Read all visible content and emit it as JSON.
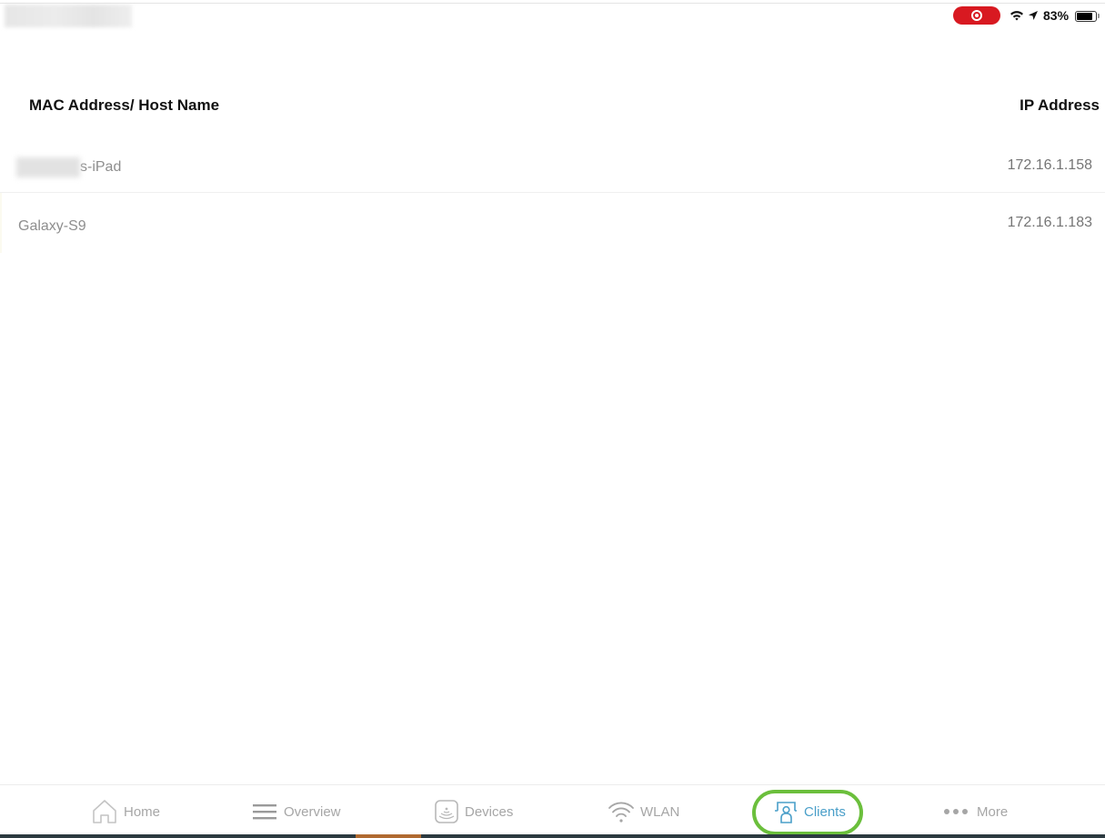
{
  "status_bar": {
    "app_title_blurred": "",
    "recording_indicator": "screen-recording",
    "battery_percent": "83%",
    "battery_level": 0.83,
    "icons": [
      "wifi-icon",
      "location-arrow-icon",
      "battery-icon"
    ]
  },
  "table": {
    "headers": {
      "host": "MAC Address/ Host Name",
      "ip": "IP Address"
    },
    "rows": [
      {
        "host_suffix": "s-iPad",
        "host_prefix_redacted": true,
        "ip": "172.16.1.158"
      },
      {
        "host": "Galaxy-S9",
        "ip": "172.16.1.183"
      }
    ]
  },
  "tab_bar": {
    "tabs": [
      {
        "id": "home",
        "label": "Home",
        "icon": "home-icon"
      },
      {
        "id": "overview",
        "label": "Overview",
        "icon": "menu-lines-icon"
      },
      {
        "id": "devices",
        "label": "Devices",
        "icon": "devices-icon"
      },
      {
        "id": "wlan",
        "label": "WLAN",
        "icon": "wifi-icon"
      },
      {
        "id": "clients",
        "label": "Clients",
        "icon": "clients-icon",
        "active": true,
        "highlighted": true
      },
      {
        "id": "more",
        "label": "More",
        "icon": "more-dots-icon"
      }
    ],
    "active_color": "#4a9fc9",
    "inactive_color": "#a6a6a6",
    "highlight_color": "#6bbf3c"
  }
}
